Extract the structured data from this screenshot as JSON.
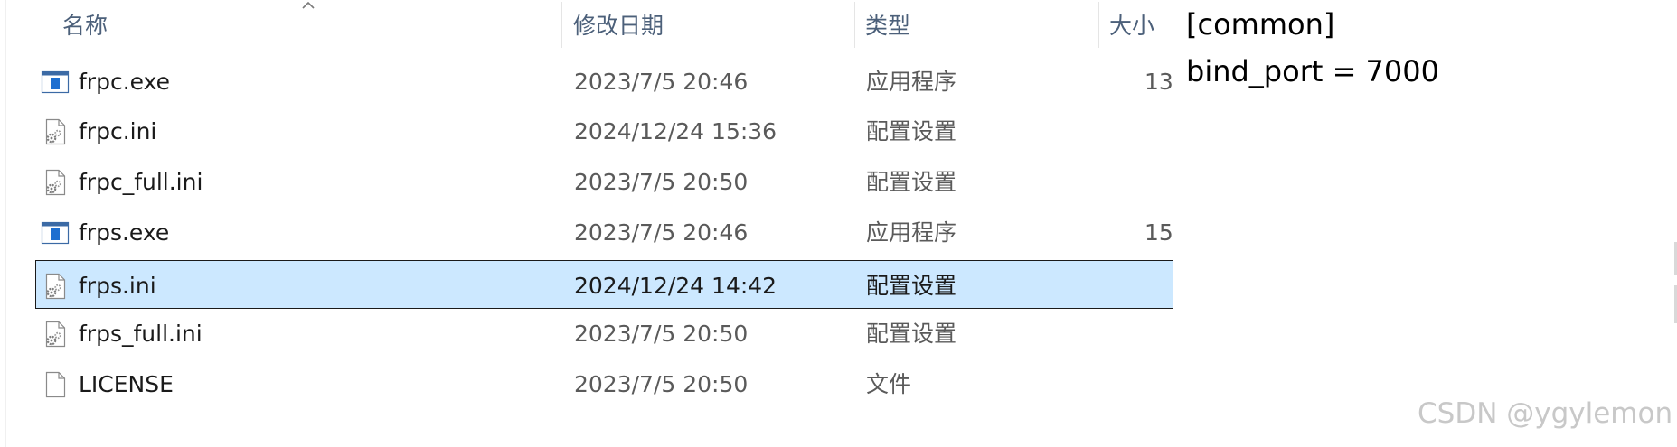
{
  "columns": {
    "name": "名称",
    "date": "修改日期",
    "type": "类型",
    "size": "大小"
  },
  "files": [
    {
      "name": "frpc.exe",
      "date": "2023/7/5 20:46",
      "type": "应用程序",
      "size": "13,",
      "icon": "exe-icon",
      "selected": false
    },
    {
      "name": "frpc.ini",
      "date": "2024/12/24 15:36",
      "type": "配置设置",
      "size": "",
      "icon": "ini-file-icon",
      "selected": false
    },
    {
      "name": "frpc_full.ini",
      "date": "2023/7/5 20:50",
      "type": "配置设置",
      "size": "",
      "icon": "ini-file-icon",
      "selected": false
    },
    {
      "name": "frps.exe",
      "date": "2023/7/5 20:46",
      "type": "应用程序",
      "size": "15,",
      "icon": "exe-icon",
      "selected": false
    },
    {
      "name": "frps.ini",
      "date": "2024/12/24 14:42",
      "type": "配置设置",
      "size": "",
      "icon": "ini-file-icon",
      "selected": true
    },
    {
      "name": "frps_full.ini",
      "date": "2023/7/5 20:50",
      "type": "配置设置",
      "size": "",
      "icon": "ini-file-icon",
      "selected": false
    },
    {
      "name": "LICENSE",
      "date": "2023/7/5 20:50",
      "type": "文件",
      "size": "",
      "icon": "blank-file-icon",
      "selected": false
    }
  ],
  "preview": {
    "lines": [
      "[common]",
      "bind_port = 7000"
    ]
  },
  "watermark": "CSDN @ygylemon",
  "colors": {
    "selection_bg": "#cce8ff",
    "header_text": "#4c607a",
    "exe_blue": "#1e6fd0"
  }
}
